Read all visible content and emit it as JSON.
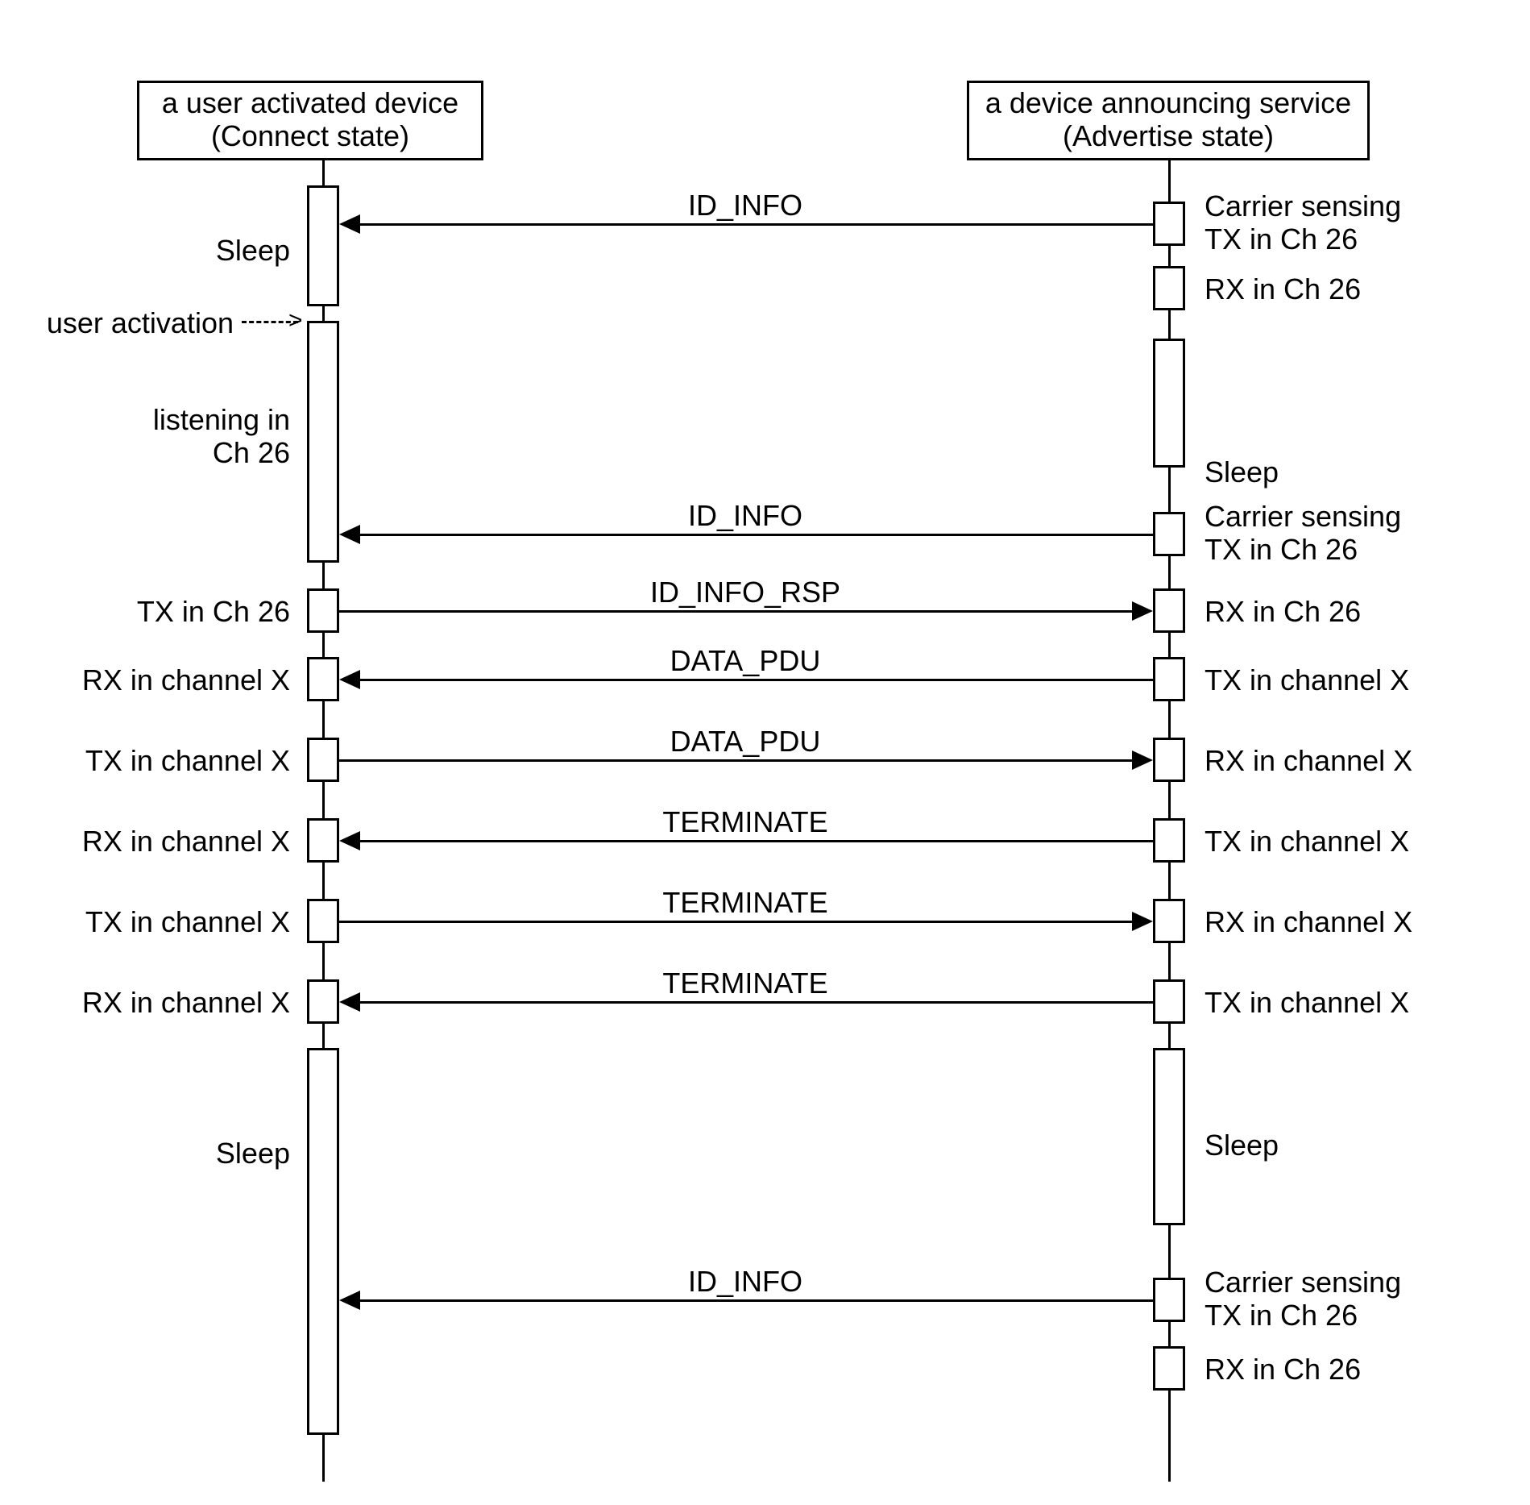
{
  "left_title_l1": "a user activated device",
  "left_title_l2": "(Connect state)",
  "right_title_l1": "a device announcing service",
  "right_title_l2": "(Advertise state)",
  "msg_id_info": "ID_INFO",
  "msg_id_info_rsp": "ID_INFO_RSP",
  "msg_data_pdu": "DATA_PDU",
  "msg_terminate": "TERMINATE",
  "left_sleep": "Sleep",
  "left_user_activation": "user activation",
  "left_listening": "listening in\nCh 26",
  "left_tx26": "TX in Ch 26",
  "left_rxX": "RX in channel X",
  "left_txX": "TX in channel X",
  "right_cs_tx26": "Carrier sensing\nTX in Ch 26",
  "right_rx26": "RX in Ch 26",
  "right_sleep": "Sleep",
  "right_txX": "TX in channel X",
  "right_rxX": "RX in channel X"
}
